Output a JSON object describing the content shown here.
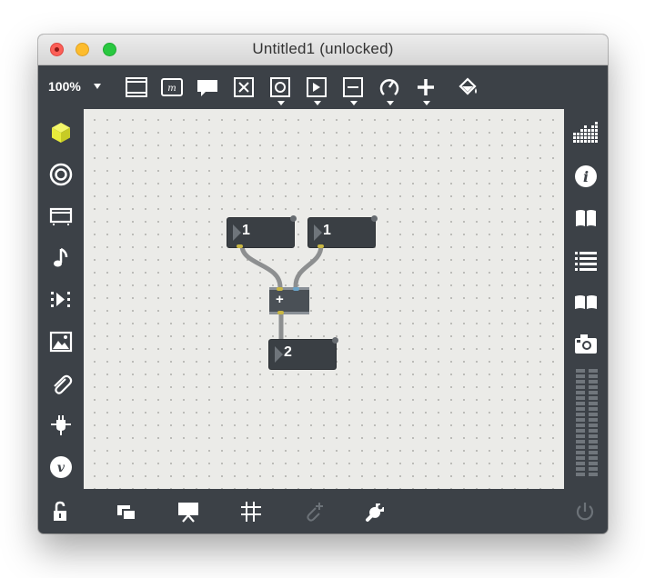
{
  "window": {
    "title": "Untitled1 (unlocked)"
  },
  "toolbar": {
    "zoom_label": "100%",
    "icons": [
      "presentation-icon",
      "message-box-icon",
      "comment-icon",
      "toggle-x-icon",
      "button-icon",
      "play-icon",
      "slider-icon",
      "dial-icon",
      "add-icon",
      "paint-bucket-icon"
    ]
  },
  "left_sidebar": {
    "icons": [
      "cube-icon",
      "target-icon",
      "device-icon",
      "music-note-icon",
      "sequence-icon",
      "image-icon",
      "paperclip-icon",
      "plug-icon",
      "vimeo-icon"
    ]
  },
  "right_sidebar": {
    "icons": [
      "grid-icon",
      "info-icon",
      "book-icon",
      "list-icon",
      "reference-icon",
      "snapshot-icon",
      "level-meter"
    ]
  },
  "patch": {
    "number_box_1": "1",
    "number_box_2": "1",
    "plus_object": "+",
    "result_box": "2"
  },
  "bottom_bar": {
    "icons": [
      "lock-icon",
      "windows-icon",
      "presentation-icon",
      "grid-icon",
      "paperclip-add-icon",
      "wrench-icon",
      "power-icon"
    ]
  },
  "colors": {
    "chrome": "#3c4147",
    "canvas": "#ebebe8",
    "accent_yellow": "#e8ec3b",
    "inlet_yellow": "#c9b743",
    "inlet_blue": "#6aa3c8"
  }
}
